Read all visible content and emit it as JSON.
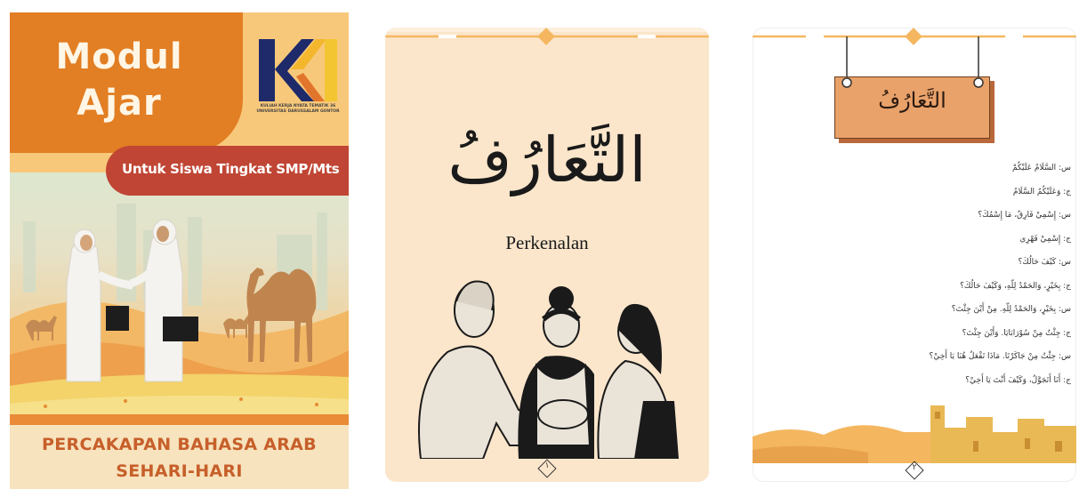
{
  "cover": {
    "title_line1": "Modul",
    "title_line2": "Ajar",
    "logo_caption": "KULIAH KERJA NYATA TEMATIK 36 UNIVERSITAS DARUSSALAM GONTOR",
    "ribbon": "Untuk Siswa Tingkat SMP/Mts",
    "subtitle_line1": "PERCAKAPAN  BAHASA ARAB",
    "subtitle_line2": "SEHARI-HARI"
  },
  "page1": {
    "title": "التَّعَارُفُ",
    "subtitle": "Perkenalan",
    "page_number": "١"
  },
  "page2": {
    "sign_title": "التَّعَارُفُ",
    "dialogue": [
      "س: السَّلَامُ عَلَيْكُمْ",
      "ج: وَعَلَيْكُمُ السَّلَامُ",
      "س: إِسْمِيْ فَارِقٌ، مَا إِسْمُكَ؟",
      "ج: إِسْمِيْ فَهْرِي",
      "س: كَيْفَ حَالُكَ؟",
      "ج: بِخَيْرٍ، وَالحَمْدُ لِلّهِ، وَكَيْفَ حَالُكَ؟",
      "س: بِخَيْرٍ، وَالحَمْدُ لِلّهِ. مِنْ أَيْنَ جِئْتَ؟",
      "ج: جِئْتُ مِنْ سُوْرَابَايَا. وَأَيْنَ جِئْتَ؟",
      "س: جِئْتُ مِنْ جَاكَرْتَا. مَاذَا تَفْعَلُ هُنَا يَا أَخِيْ؟",
      "ج: أَنَا أَتَجَوَّلُ، وَكَيْفَ أَنْتَ يَا أَخِيْ؟"
    ],
    "page_number": "٢"
  },
  "colors": {
    "cover_orange": "#e27e23",
    "ribbon_red": "#c04534",
    "cover_cream": "#f7e3bd",
    "page1_bg": "#fbe6cb",
    "sign_orange": "#e9a26a",
    "accent_gold": "#f4b760"
  }
}
